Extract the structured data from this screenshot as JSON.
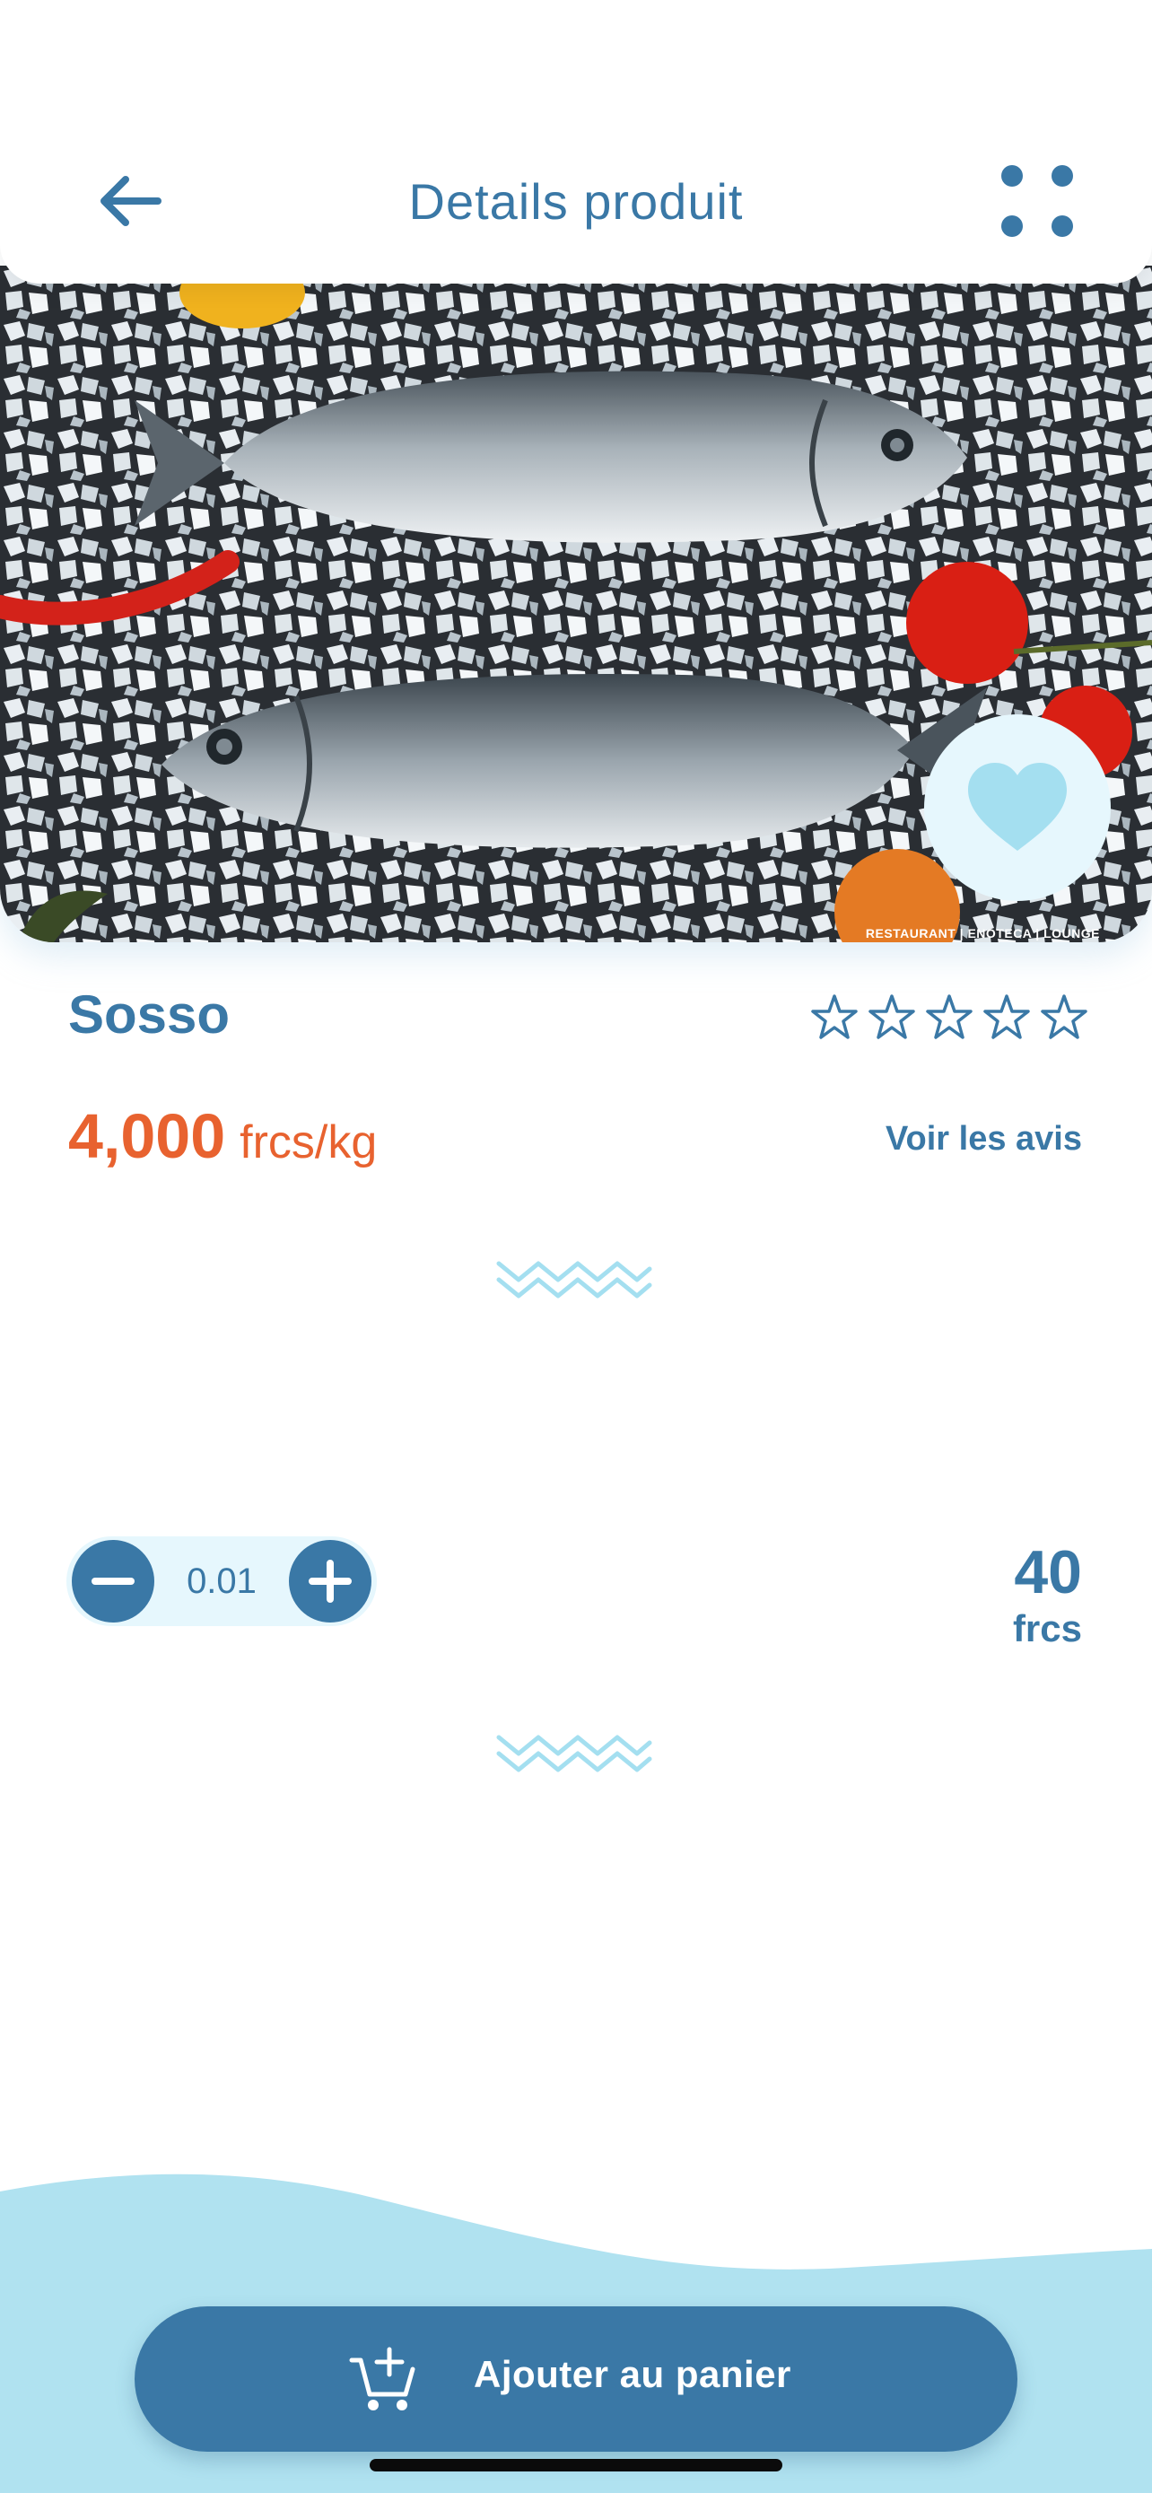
{
  "header": {
    "title": "Details produit",
    "back_icon": "arrow-left-icon",
    "menu_icon": "grid-dots-icon"
  },
  "hero": {
    "image_description": "two sea bass on crushed ice with tomatoes, chili and lemon",
    "watermark": "RESTAURANT | ENOTECA | LOUNGE",
    "favorite_icon": "heart-icon"
  },
  "product": {
    "name": "Sosso",
    "rating": 0,
    "rating_max": 5,
    "price_value": "4,000",
    "price_unit": "frcs/kg",
    "reviews_link": "Voir les avis"
  },
  "quantity": {
    "value": "0.01",
    "minus_icon": "minus-icon",
    "plus_icon": "plus-icon"
  },
  "total": {
    "value": "40",
    "unit": "frcs"
  },
  "cart_button": {
    "label": "Ajouter au panier",
    "icon": "cart-add-icon"
  },
  "colors": {
    "primary": "#3a78a6",
    "accent_price": "#e8622f",
    "light_blue": "#e6f7fd",
    "wave_blue": "#b0e2f0"
  }
}
